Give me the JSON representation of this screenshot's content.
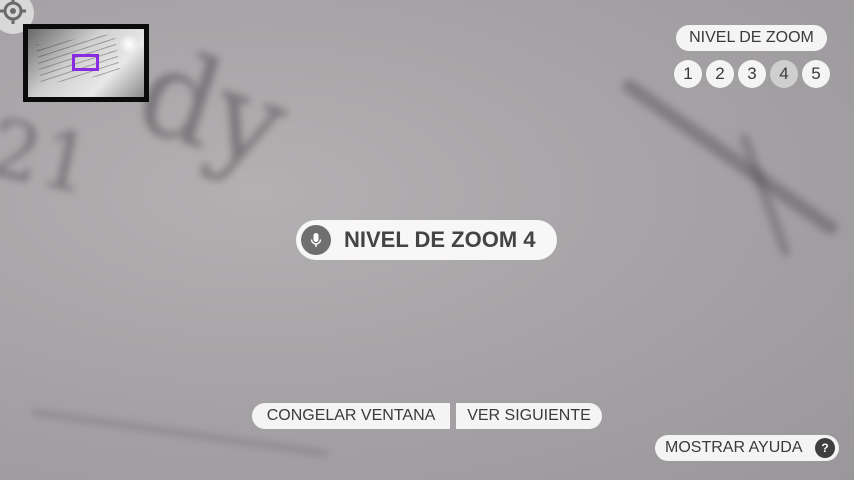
{
  "zoom_panel": {
    "title": "NIVEL DE ZOOM",
    "levels": [
      "1",
      "2",
      "3",
      "4",
      "5"
    ],
    "active_level": "4"
  },
  "status": {
    "text": "NIVEL DE ZOOM 4"
  },
  "actions": {
    "freeze_label": "CONGELAR VENTANA",
    "next_label": "VER SIGUIENTE",
    "help_label": "MOSTRAR AYUDA",
    "help_icon_glyph": "?"
  },
  "icons": {
    "target": "crosshair-icon",
    "mic": "microphone-icon",
    "help": "question-icon"
  },
  "colors": {
    "minimap_viewport": "#8a2be2",
    "pill_background": "#f4f4f4",
    "active_level": "#cfcfcf"
  }
}
